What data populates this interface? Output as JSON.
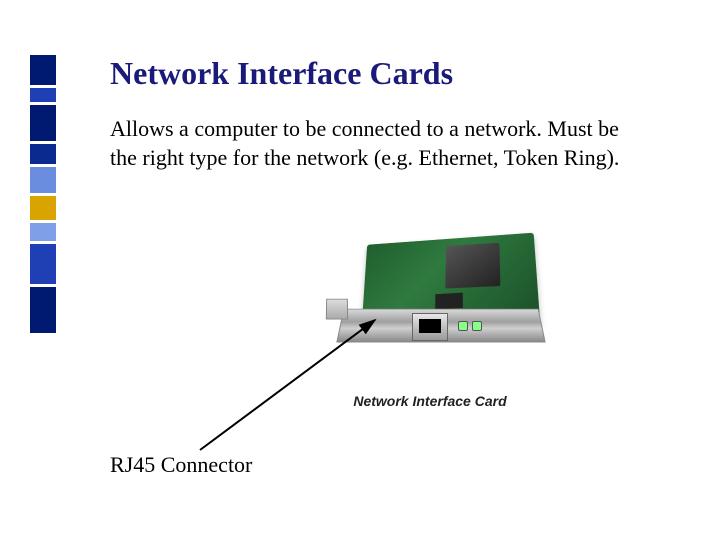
{
  "title": "Network Interface Cards",
  "body": "Allows a computer to be connected to a network. Must be the right type for the network (e.g. Ethernet, Token Ring).",
  "figure_caption": "Network Interface Card",
  "connector_label": "RJ45 Connector",
  "decor_colors": [
    "#001a72",
    "#1f3fb5",
    "#001a72",
    "#0a2a90",
    "#6a8de0",
    "#d9a400",
    "#7fa0e8",
    "#1f3fb5",
    "#001a72"
  ],
  "decor_heights": [
    30,
    14,
    36,
    20,
    26,
    24,
    18,
    40,
    46
  ]
}
